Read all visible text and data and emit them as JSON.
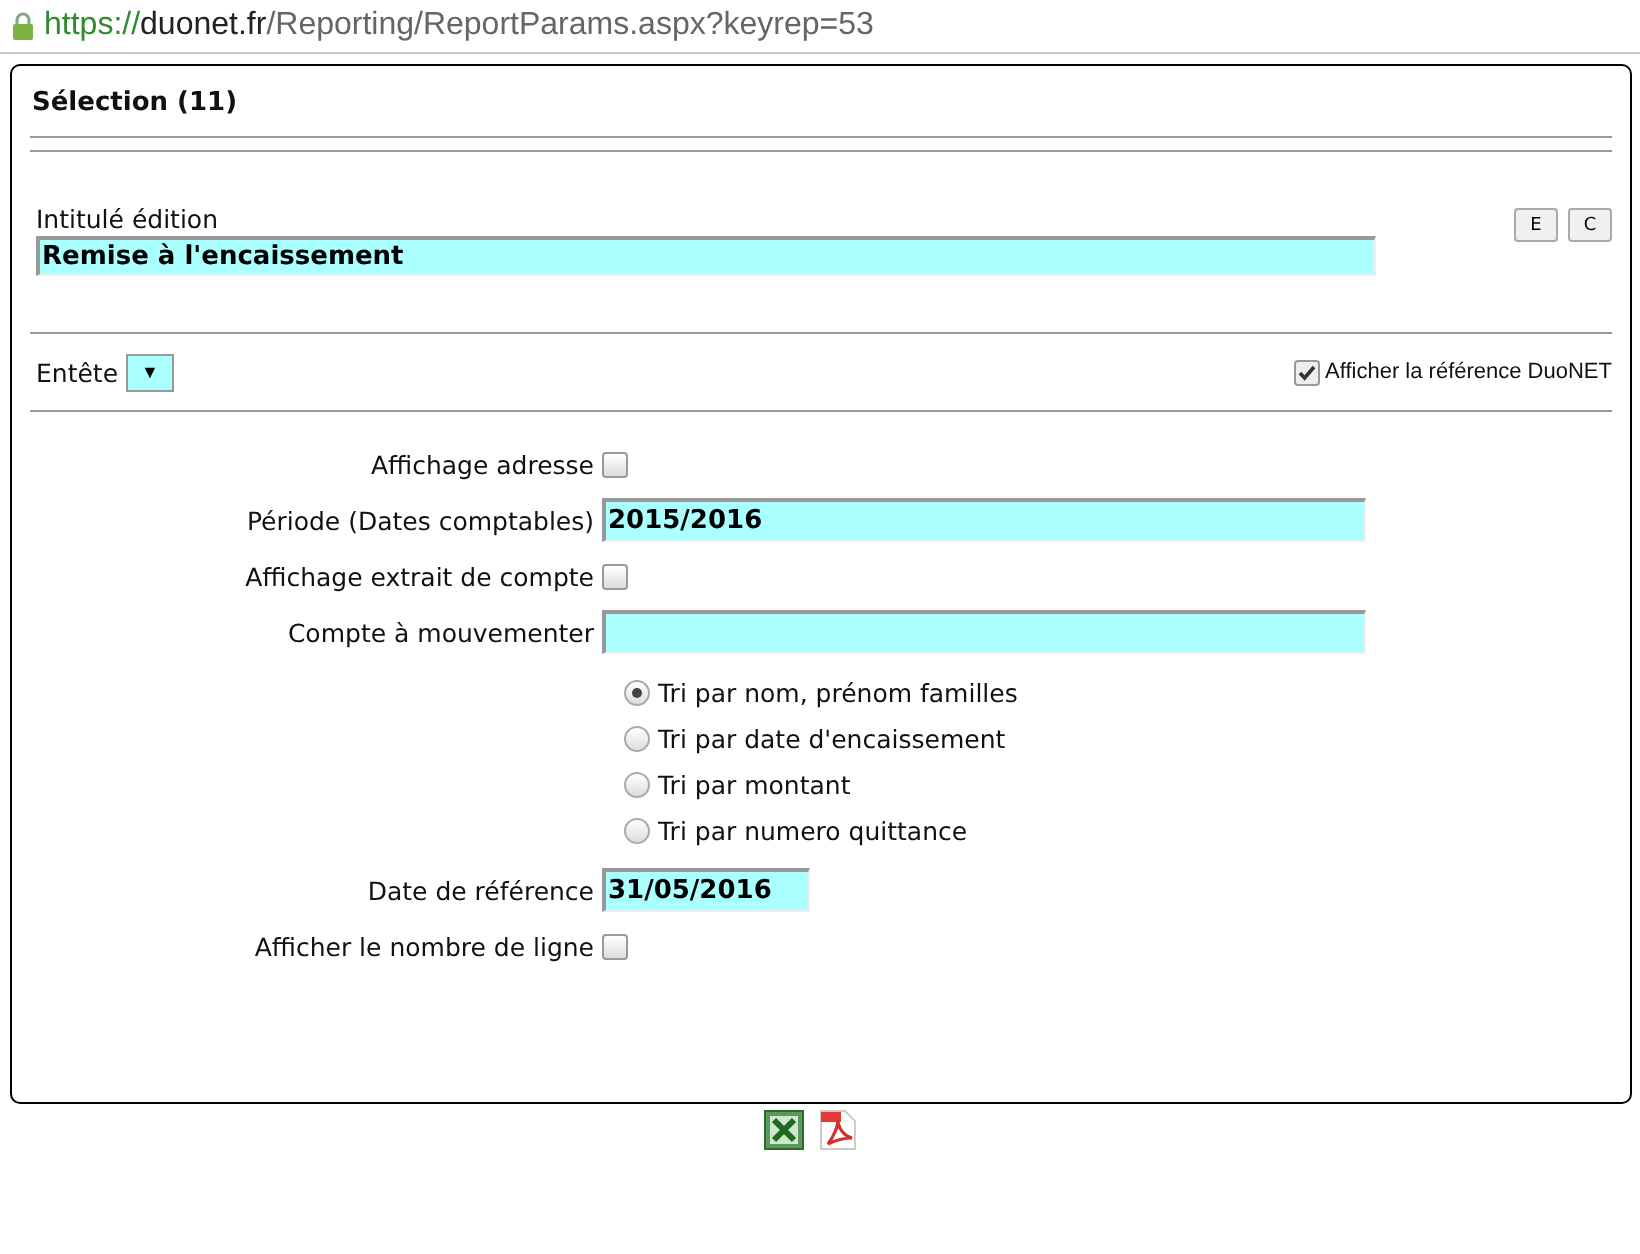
{
  "address_bar": {
    "scheme": "https://",
    "host": "duonet.fr",
    "path": "/Reporting/ReportParams.aspx?keyrep=53"
  },
  "panel": {
    "title": "Sélection (11)"
  },
  "edition": {
    "label": "Intitulé édition",
    "value": "Remise à l'encaissement",
    "buttons": [
      "E",
      "C"
    ]
  },
  "header": {
    "label": "Entête",
    "dropdown_arrow": "▼",
    "reference_checkbox": {
      "label": "Afficher la référence DuoNET",
      "checked": true
    }
  },
  "fields": [
    {
      "kind": "checkbox",
      "label": "Affichage adresse",
      "checked": false
    },
    {
      "kind": "text",
      "label": "Période (Dates comptables)",
      "value": "2015/2016"
    },
    {
      "kind": "checkbox",
      "label": "Affichage extrait de compte",
      "checked": false
    },
    {
      "kind": "text",
      "label": "Compte à mouvementer"
    },
    {
      "kind": "radios",
      "options": [
        {
          "label": "Tri par nom, prénom familles",
          "selected": true
        },
        {
          "label": "Tri par date d'encaissement",
          "selected": false
        },
        {
          "label": "Tri par montant",
          "selected": false
        },
        {
          "label": "Tri par numero quittance",
          "selected": false
        }
      ]
    },
    {
      "kind": "date",
      "label": "Date de référence",
      "value": "31/05/2016"
    },
    {
      "kind": "checkbox",
      "label": "Afficher le nombre de ligne",
      "checked": false
    }
  ]
}
